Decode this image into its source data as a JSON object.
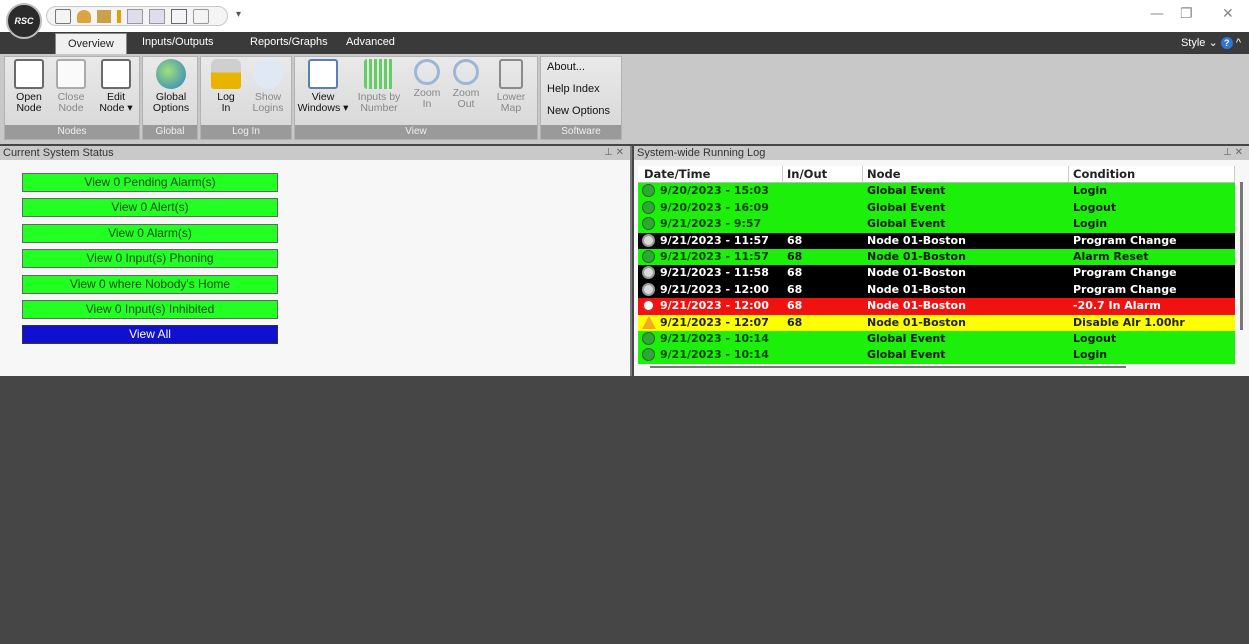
{
  "titlebar": {
    "logo": "RSC",
    "qat_icons": [
      "add-node-icon",
      "users-icon",
      "edit-icon",
      "bar-chart-icon",
      "all-avg-icon",
      "all-icon",
      "window-icon",
      "pdf-icon"
    ],
    "minimize": "—",
    "restore": "❐",
    "close": "✕"
  },
  "tabs": [
    {
      "label": "Overview",
      "active": true
    },
    {
      "label": "Inputs/Outputs",
      "active": false
    },
    {
      "label": "Reports/Graphs",
      "active": false
    },
    {
      "label": "Advanced",
      "active": false
    }
  ],
  "style_menu": {
    "label": "Style",
    "chevron": "⌄",
    "help": "?",
    "collapse": "^"
  },
  "ribbon": {
    "groups": {
      "nodes": {
        "label": "Nodes",
        "open_node": "Open\nNode",
        "close_node": "Close\nNode",
        "edit_node": "Edit\nNode ▾"
      },
      "global": {
        "label": "Global",
        "global_options": "Global\nOptions"
      },
      "login": {
        "label": "Log In",
        "log_in": "Log\nIn",
        "show_logins": "Show\nLogins"
      },
      "view": {
        "label": "View",
        "view_windows": "View\nWindows ▾",
        "inputs_by_number": "Inputs by\nNumber",
        "zoom_in": "Zoom\nIn",
        "zoom_out": "Zoom\nOut",
        "lower_map": "Lower\nMap"
      },
      "software": {
        "label": "Software",
        "about": "About...",
        "help_index": "Help Index",
        "new_options": "New Options"
      }
    }
  },
  "left_panel": {
    "title": "Current System Status",
    "pin": "⊥ ✕",
    "buttons": [
      "View 0 Pending Alarm(s)",
      "View 0 Alert(s)",
      "View 0 Alarm(s)",
      "View 0 Input(s) Phoning",
      "View 0 where Nobody's Home",
      "View 0 Input(s) Inhibited",
      "View All"
    ]
  },
  "right_panel": {
    "title": "System-wide Running Log",
    "pin": "⊥ ✕",
    "columns": [
      "Date/Time",
      "In/Out",
      "Node",
      "Condition"
    ],
    "rows": [
      {
        "dt": "9/20/2023 - 15:03",
        "io": "",
        "node": "Global Event",
        "cond": "Login",
        "color": "green",
        "icon": "check-icon"
      },
      {
        "dt": "9/20/2023 - 16:09",
        "io": "",
        "node": "Global Event",
        "cond": "Logout",
        "color": "green",
        "icon": "check-icon"
      },
      {
        "dt": "9/21/2023 - 9:57",
        "io": "",
        "node": "Global Event",
        "cond": "Login",
        "color": "green",
        "icon": "check-icon"
      },
      {
        "dt": "9/21/2023 - 11:57",
        "io": "68",
        "node": "Node 01-Boston",
        "cond": "Program Change",
        "color": "black",
        "icon": "gear-icon"
      },
      {
        "dt": "9/21/2023 - 11:57",
        "io": "68",
        "node": "Node 01-Boston",
        "cond": "Alarm Reset",
        "color": "green",
        "icon": "check-icon"
      },
      {
        "dt": "9/21/2023 - 11:58",
        "io": "68",
        "node": "Node 01-Boston",
        "cond": "Program Change",
        "color": "black",
        "icon": "gear-icon"
      },
      {
        "dt": "9/21/2023 - 12:00",
        "io": "68",
        "node": "Node 01-Boston",
        "cond": "Program Change",
        "color": "black",
        "icon": "gear-icon"
      },
      {
        "dt": "9/21/2023 - 12:00",
        "io": "68",
        "node": "Node 01-Boston",
        "cond": "-20.7  In Alarm",
        "color": "red",
        "icon": "clock-icon"
      },
      {
        "dt": "9/21/2023 - 12:07",
        "io": "68",
        "node": "Node 01-Boston",
        "cond": "Disable Alr  1.00hr",
        "color": "yellow",
        "icon": "warning-icon"
      },
      {
        "dt": "9/21/2023 - 10:14",
        "io": "",
        "node": "Global Event",
        "cond": "Logout",
        "color": "green",
        "icon": "check-icon"
      },
      {
        "dt": "9/21/2023 - 10:14",
        "io": "",
        "node": "Global Event",
        "cond": "Login",
        "color": "green",
        "icon": "check-icon"
      }
    ]
  },
  "colors": {
    "green": "#1cf00a",
    "black": "#000000",
    "red": "#f21111",
    "yellow": "#ffff00",
    "view_all": "#1010d0"
  }
}
